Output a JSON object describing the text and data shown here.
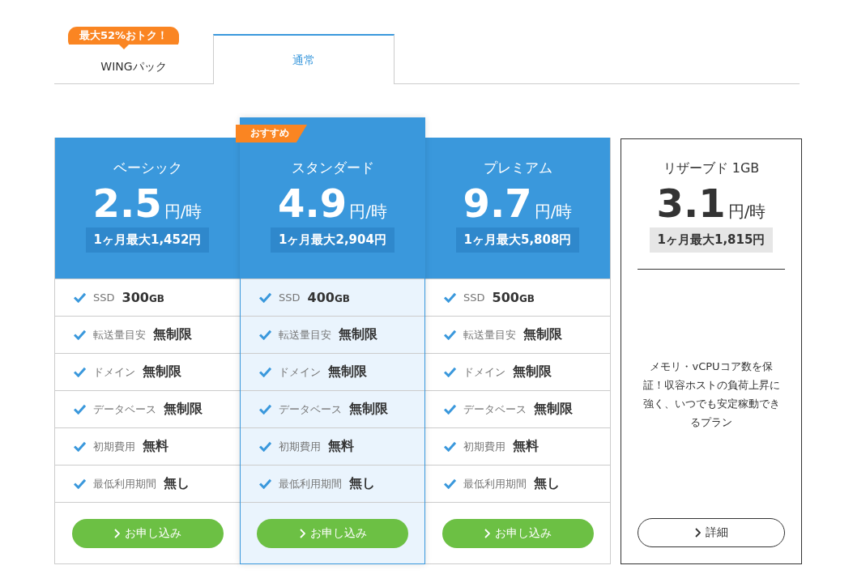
{
  "tabs": [
    {
      "label": "WINGパック",
      "selected": false,
      "badge": "最大52%おトク！"
    },
    {
      "label": "通常",
      "selected": true
    }
  ],
  "plans": [
    {
      "name": "ベーシック",
      "price": "2.5",
      "unit": "円/時",
      "monthly": "1ヶ月最大1,452円",
      "highlighted": false,
      "features": [
        {
          "label": "SSD",
          "value": "300",
          "suffix": "GB"
        },
        {
          "label": "転送量目安",
          "value": "無制限"
        },
        {
          "label": "ドメイン",
          "value": "無制限"
        },
        {
          "label": "データベース",
          "value": "無制限"
        },
        {
          "label": "初期費用",
          "value": "無料"
        },
        {
          "label": "最低利用期間",
          "value": "無し"
        }
      ],
      "button": "お申し込み"
    },
    {
      "name": "スタンダード",
      "price": "4.9",
      "unit": "円/時",
      "monthly": "1ヶ月最大2,904円",
      "highlighted": true,
      "ribbon": "おすすめ",
      "features": [
        {
          "label": "SSD",
          "value": "400",
          "suffix": "GB"
        },
        {
          "label": "転送量目安",
          "value": "無制限"
        },
        {
          "label": "ドメイン",
          "value": "無制限"
        },
        {
          "label": "データベース",
          "value": "無制限"
        },
        {
          "label": "初期費用",
          "value": "無料"
        },
        {
          "label": "最低利用期間",
          "value": "無し"
        }
      ],
      "button": "お申し込み"
    },
    {
      "name": "プレミアム",
      "price": "9.7",
      "unit": "円/時",
      "monthly": "1ヶ月最大5,808円",
      "highlighted": false,
      "features": [
        {
          "label": "SSD",
          "value": "500",
          "suffix": "GB"
        },
        {
          "label": "転送量目安",
          "value": "無制限"
        },
        {
          "label": "ドメイン",
          "value": "無制限"
        },
        {
          "label": "データベース",
          "value": "無制限"
        },
        {
          "label": "初期費用",
          "value": "無料"
        },
        {
          "label": "最低利用期間",
          "value": "無し"
        }
      ],
      "button": "お申し込み"
    }
  ],
  "reserved": {
    "name": "リザーブド 1GB",
    "price": "3.1",
    "unit": "円/時",
    "monthly": "1ヶ月最大1,815円",
    "description": "メモリ・vCPUコア数を保証！収容ホストの負荷上昇に強く、いつでも安定稼動できるプラン",
    "button": "詳細"
  }
}
